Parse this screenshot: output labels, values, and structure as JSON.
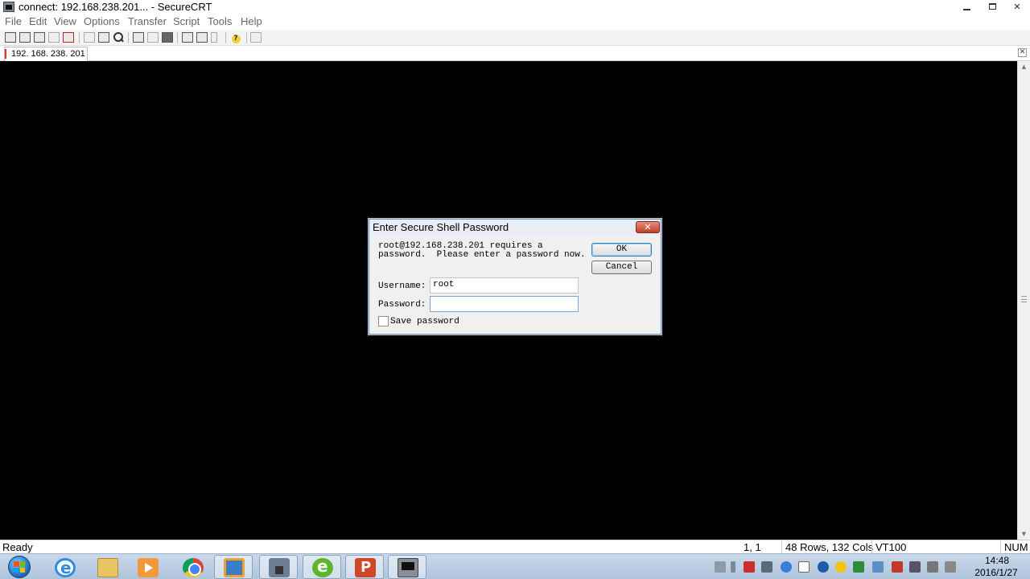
{
  "window": {
    "title": "connect: 192.168.238.201... - SecureCRT"
  },
  "menu": [
    "File",
    "Edit",
    "View",
    "Options",
    "Transfer",
    "Script",
    "Tools",
    "Help"
  ],
  "session_tab": {
    "label": "192. 168. 238. 201"
  },
  "dialog": {
    "title": "Enter Secure Shell Password",
    "message_line1": "root@192.168.238.201 requires a",
    "message_line2": "password.  Please enter a password now.",
    "username_label": "Username:",
    "username_value": "root",
    "password_label": "Password:",
    "password_value": "",
    "save_password_label": "Save password",
    "save_password_checked": false,
    "ok_label": "OK",
    "cancel_label": "Cancel"
  },
  "statusbar": {
    "ready": "Ready",
    "cursor": "1,   1",
    "size": "48 Rows, 132 Cols",
    "emulation": "VT100",
    "num": "NUM"
  },
  "taskbar": {
    "time": "14:48",
    "date": "2016/1/27"
  },
  "colors": {
    "terminal_background": "#000000",
    "dialog_background": "#f0f0f0",
    "close_button": "#c4402a"
  }
}
